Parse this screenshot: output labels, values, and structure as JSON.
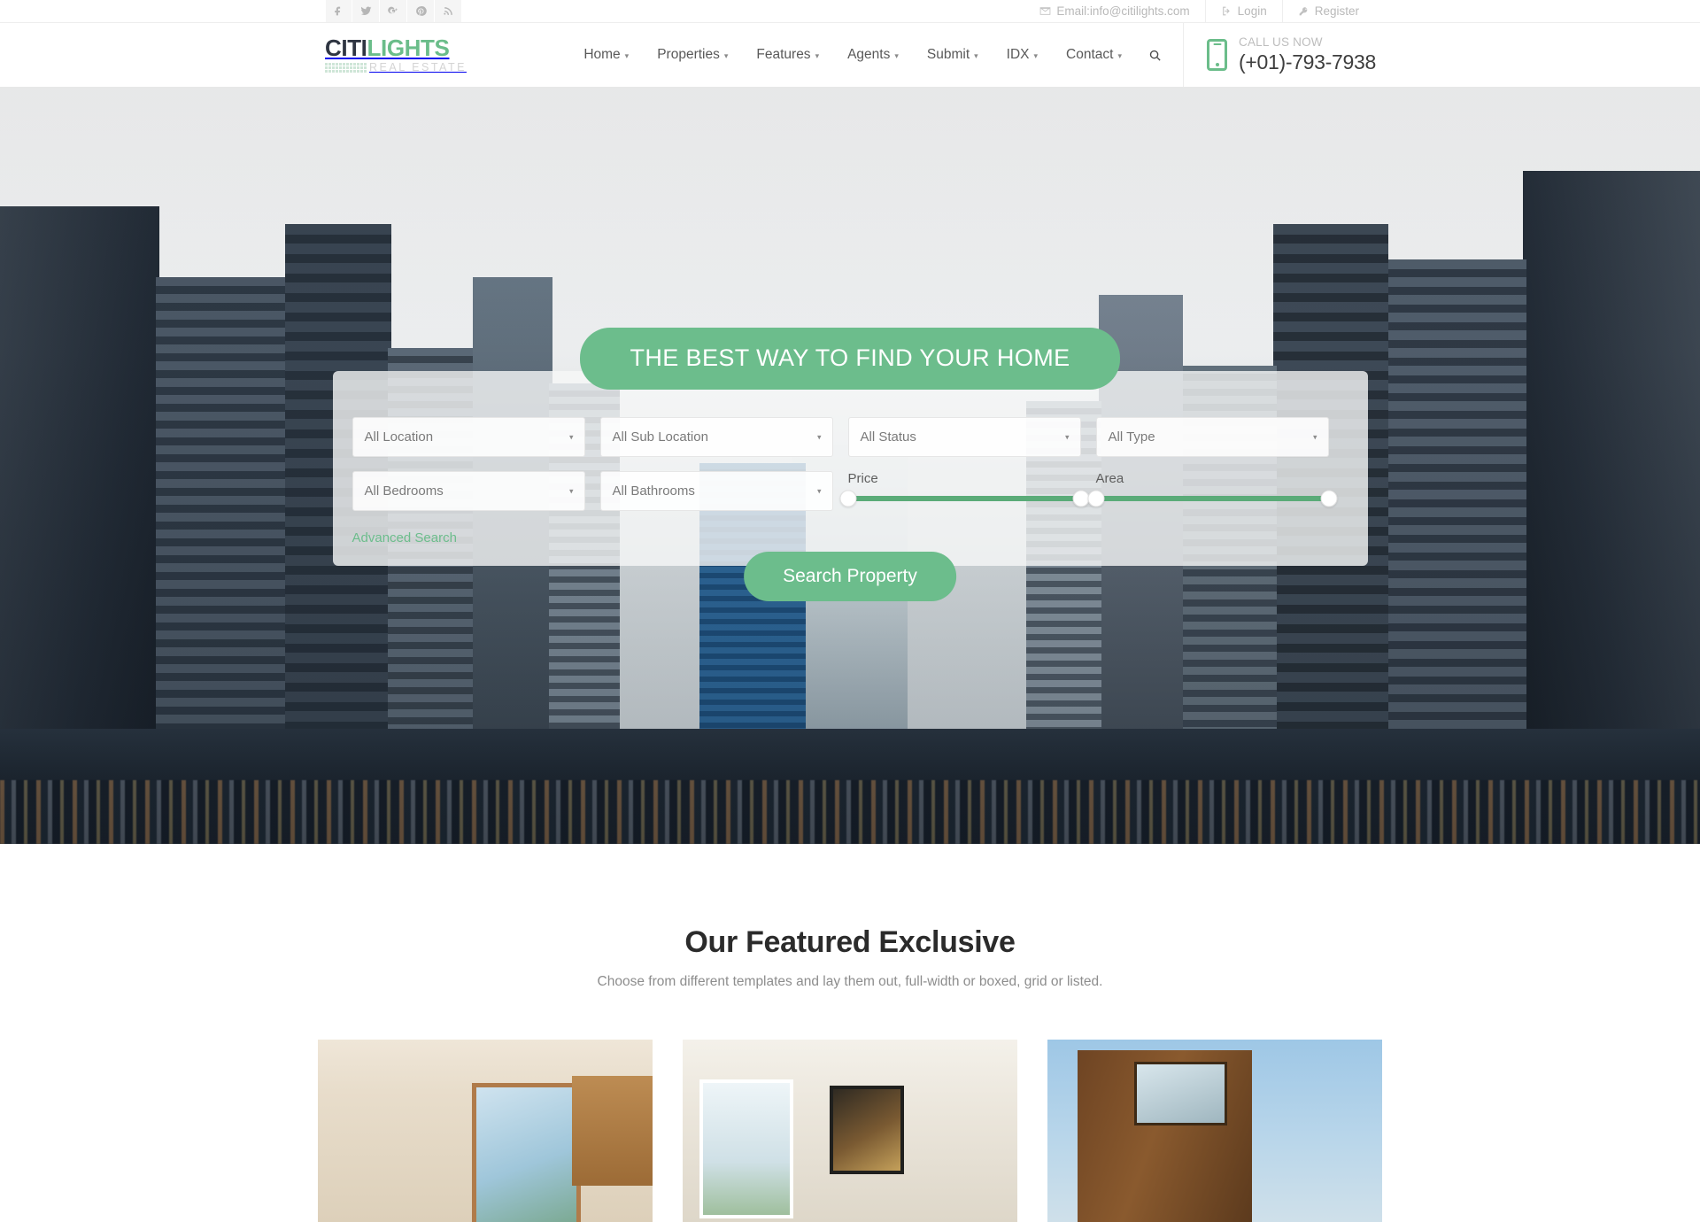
{
  "topbar": {
    "social": [
      {
        "name": "facebook-icon",
        "label": "Facebook"
      },
      {
        "name": "twitter-icon",
        "label": "Twitter"
      },
      {
        "name": "google-plus-icon",
        "label": "Google Plus"
      },
      {
        "name": "pinterest-icon",
        "label": "Pinterest"
      },
      {
        "name": "rss-icon",
        "label": "RSS"
      }
    ],
    "email": "Email:info@citilights.com",
    "login": "Login",
    "register": "Register"
  },
  "header": {
    "logo": {
      "part1": "CITI",
      "part2": "LIGHTS",
      "tagline": "REAL ESTATE"
    },
    "nav": [
      {
        "label": "Home",
        "caret": "▾"
      },
      {
        "label": "Properties",
        "caret": "▾"
      },
      {
        "label": "Features",
        "caret": "▾"
      },
      {
        "label": "Agents",
        "caret": "▾"
      },
      {
        "label": "Submit",
        "caret": "▾"
      },
      {
        "label": "IDX",
        "caret": "▾"
      },
      {
        "label": "Contact",
        "caret": "▾"
      }
    ],
    "call": {
      "label": "CALL US NOW",
      "number": "(+01)-793-7938"
    }
  },
  "hero": {
    "title": "THE BEST WAY TO FIND YOUR HOME",
    "selects": [
      {
        "value": "All Location",
        "arrow": "▾"
      },
      {
        "value": "All Sub Location",
        "arrow": "▾"
      },
      {
        "value": "All Status",
        "arrow": "▾"
      },
      {
        "value": "All Type",
        "arrow": "▾"
      },
      {
        "value": "All Bedrooms",
        "arrow": "▾"
      },
      {
        "value": "All Bathrooms",
        "arrow": "▾"
      }
    ],
    "sliders": [
      {
        "label": "Price"
      },
      {
        "label": "Area"
      }
    ],
    "advanced_search": "Advanced Search",
    "search_button": "Search Property",
    "accent_color": "#6cbd8c"
  },
  "featured": {
    "title": "Our Featured Exclusive",
    "subtitle": "Choose from different templates and lay them out, full-width or boxed, grid or listed.",
    "cards": [
      {
        "alt": "Kitchen and dining interior"
      },
      {
        "alt": "Living room with large windows"
      },
      {
        "alt": "Modern timber clad house exterior"
      }
    ]
  }
}
